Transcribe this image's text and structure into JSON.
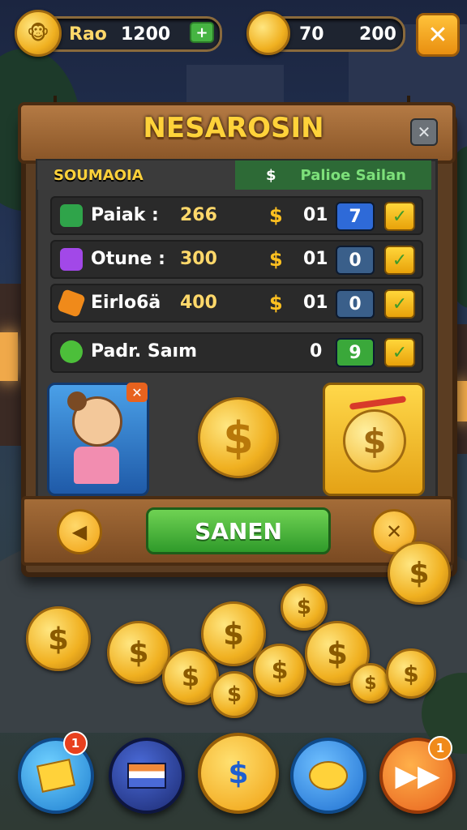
{
  "hud": {
    "left_label": "Rao",
    "left_value": "1200",
    "left_plus": "+",
    "right_label": "70",
    "right_value": "200",
    "close": "✕"
  },
  "panel": {
    "title": "NESAROSIN",
    "close": "✕",
    "sub_left": "SOUMAOIA",
    "sub_right_symbol": "$",
    "sub_right": "Palioe Sailan",
    "rows": [
      {
        "label": "Paiak :",
        "amount": "266",
        "dollar": "$",
        "qty": "01",
        "box": "7",
        "check": "✓",
        "box_color": "#2e6ad8",
        "icon_color": "#2fa44a"
      },
      {
        "label": "Otune :",
        "amount": "300",
        "dollar": "$",
        "qty": "01",
        "box": "0",
        "check": "✓",
        "box_color": "#3a5f8a",
        "icon_color": "#a248e8"
      },
      {
        "label": "Eirlo6ä",
        "amount": "400",
        "dollar": "$",
        "qty": "01",
        "box": "0",
        "check": "✓",
        "box_color": "#3a5f8a",
        "icon_color": "#f08a1a"
      }
    ],
    "summary": {
      "label": "Padr. Saım",
      "qty": "0",
      "box": "9",
      "check": "✓"
    },
    "coin_symbol": "$",
    "reward_symbol": "$",
    "action_button": "SANEN",
    "left_arrow": "◀",
    "right_close": "✕"
  },
  "bottom_nav": [
    {
      "name": "cards",
      "badge": "1"
    },
    {
      "name": "wallet"
    },
    {
      "name": "shop"
    },
    {
      "name": "chat"
    },
    {
      "name": "skip",
      "badge": "1"
    }
  ],
  "coin_glyph": "$"
}
